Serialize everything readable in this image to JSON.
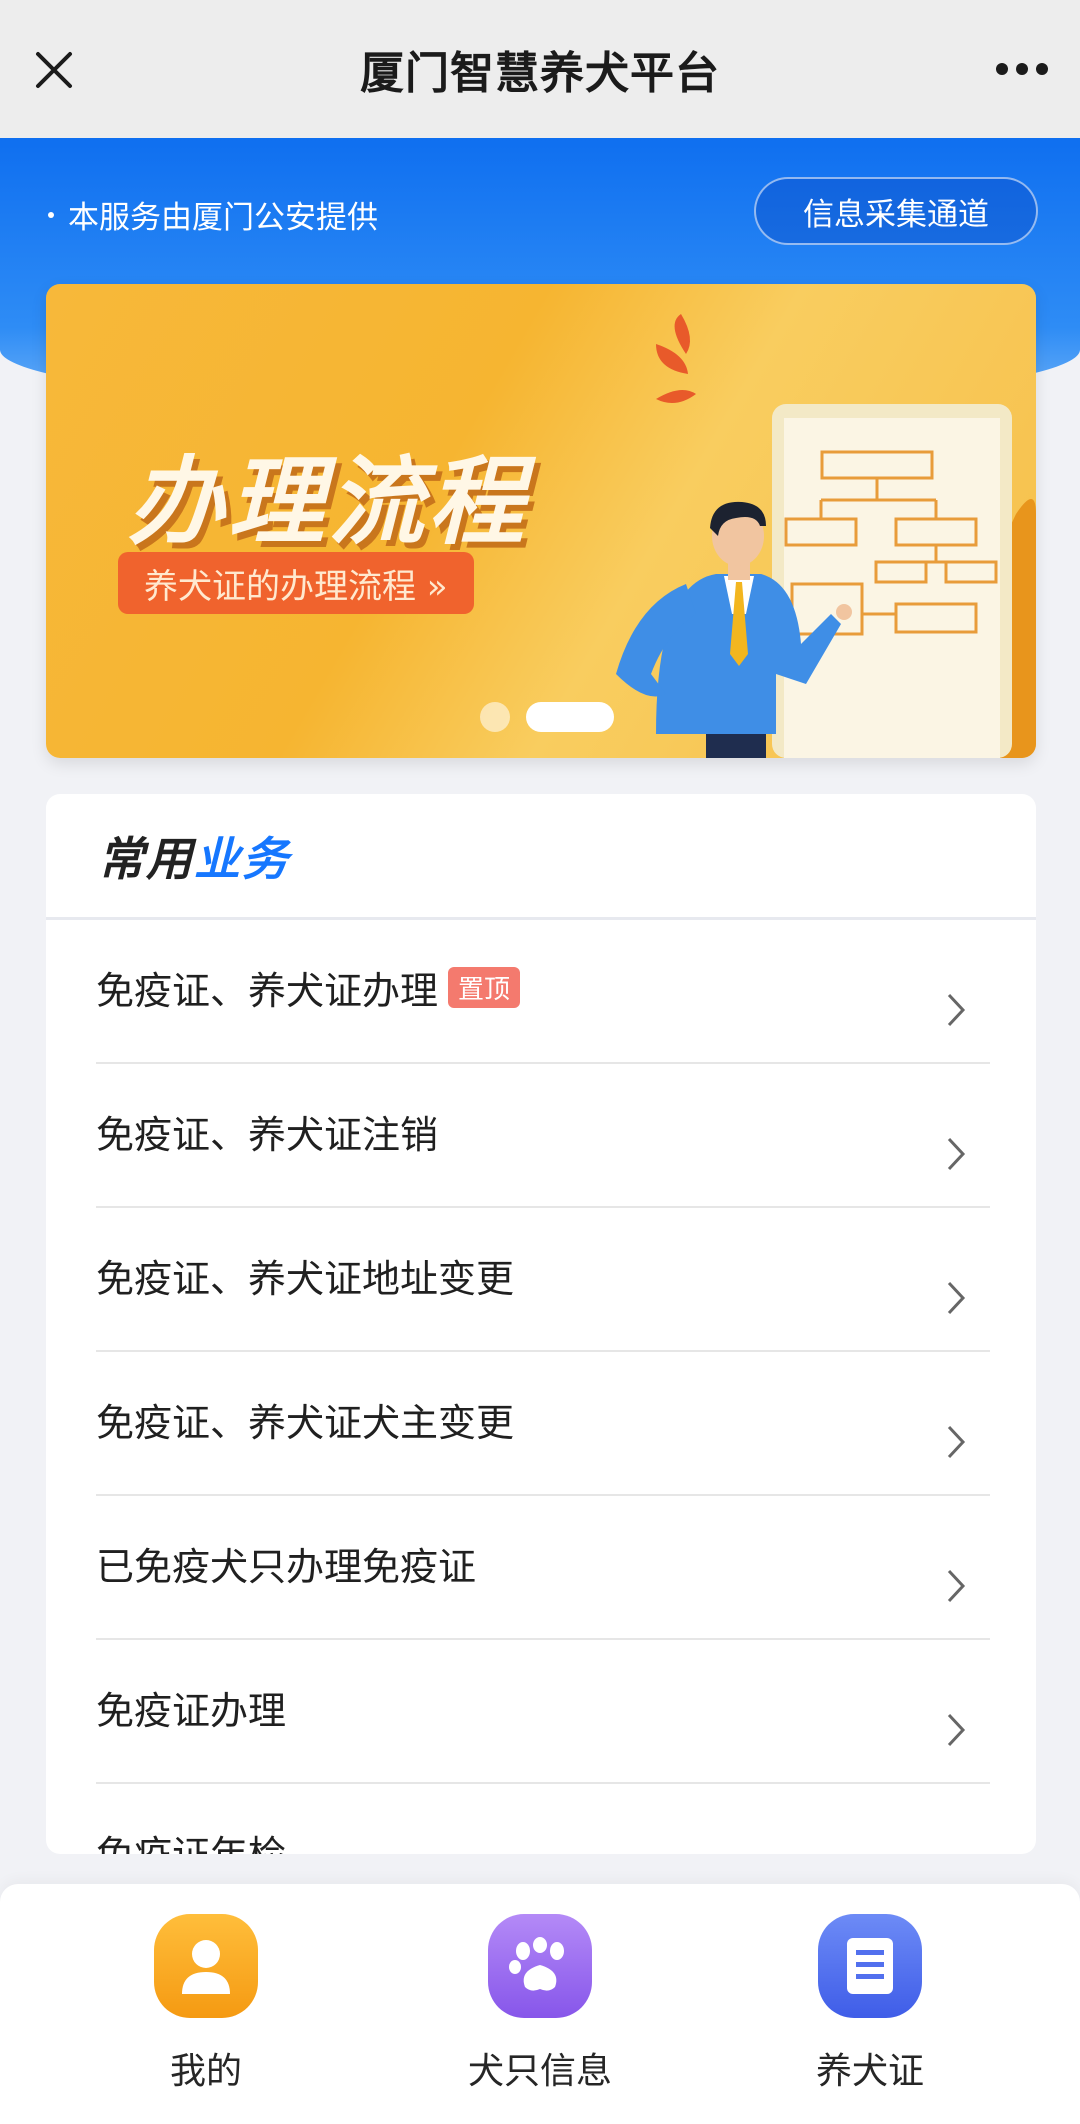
{
  "nav": {
    "title": "厦门智慧养犬平台"
  },
  "header": {
    "provider": "本服务由厦门公安提供",
    "collect_button": "信息采集通道"
  },
  "banner": {
    "title": "办理流程",
    "subtitle": "养犬证的办理流程 »",
    "slides_total": 2,
    "active_slide": 2
  },
  "card": {
    "title_part1": "常用",
    "title_part2": "业务"
  },
  "list": [
    {
      "label": "免疫证、养犬证办理",
      "badge": "置顶"
    },
    {
      "label": "免疫证、养犬证注销"
    },
    {
      "label": "免疫证、养犬证地址变更"
    },
    {
      "label": "免疫证、养犬证犬主变更"
    },
    {
      "label": "已免疫犬只办理免疫证"
    },
    {
      "label": "免疫证办理"
    },
    {
      "label": "免疫证年检"
    }
  ],
  "tabs": [
    {
      "label": "我的",
      "icon": "person-icon",
      "color": "#f7a51a"
    },
    {
      "label": "犬只信息",
      "icon": "paw-icon",
      "color": "#9b6cf0"
    },
    {
      "label": "养犬证",
      "icon": "document-icon",
      "color": "#4a6cf0"
    }
  ]
}
